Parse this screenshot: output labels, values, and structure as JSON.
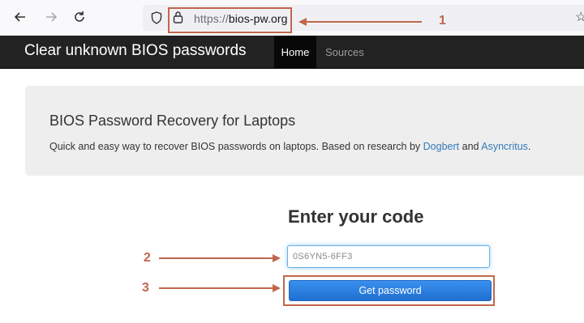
{
  "browser": {
    "url_scheme": "https://",
    "url_host": "bios-pw.org",
    "icons": [
      "back-arrow-icon",
      "forward-arrow-icon",
      "reload-icon",
      "shield-icon",
      "lock-icon",
      "bookmark-star-icon"
    ]
  },
  "navbar": {
    "brand": "Clear unknown BIOS passwords",
    "items": [
      "Home",
      "Sources"
    ],
    "active": "Home"
  },
  "jumbotron": {
    "title": "BIOS Password Recovery for Laptops",
    "desc_before": "Quick and easy way to recover BIOS passwords on laptops. Based on research by ",
    "link1": "Dogbert",
    "desc_mid": " and ",
    "link2": "Asyncritus",
    "desc_after": "."
  },
  "form": {
    "title": "Enter your code",
    "input_value": "0S6YN5-6FF3",
    "button": "Get password"
  },
  "annotations": {
    "color": "#c0674b",
    "markers": [
      "1",
      "2",
      "3"
    ]
  }
}
